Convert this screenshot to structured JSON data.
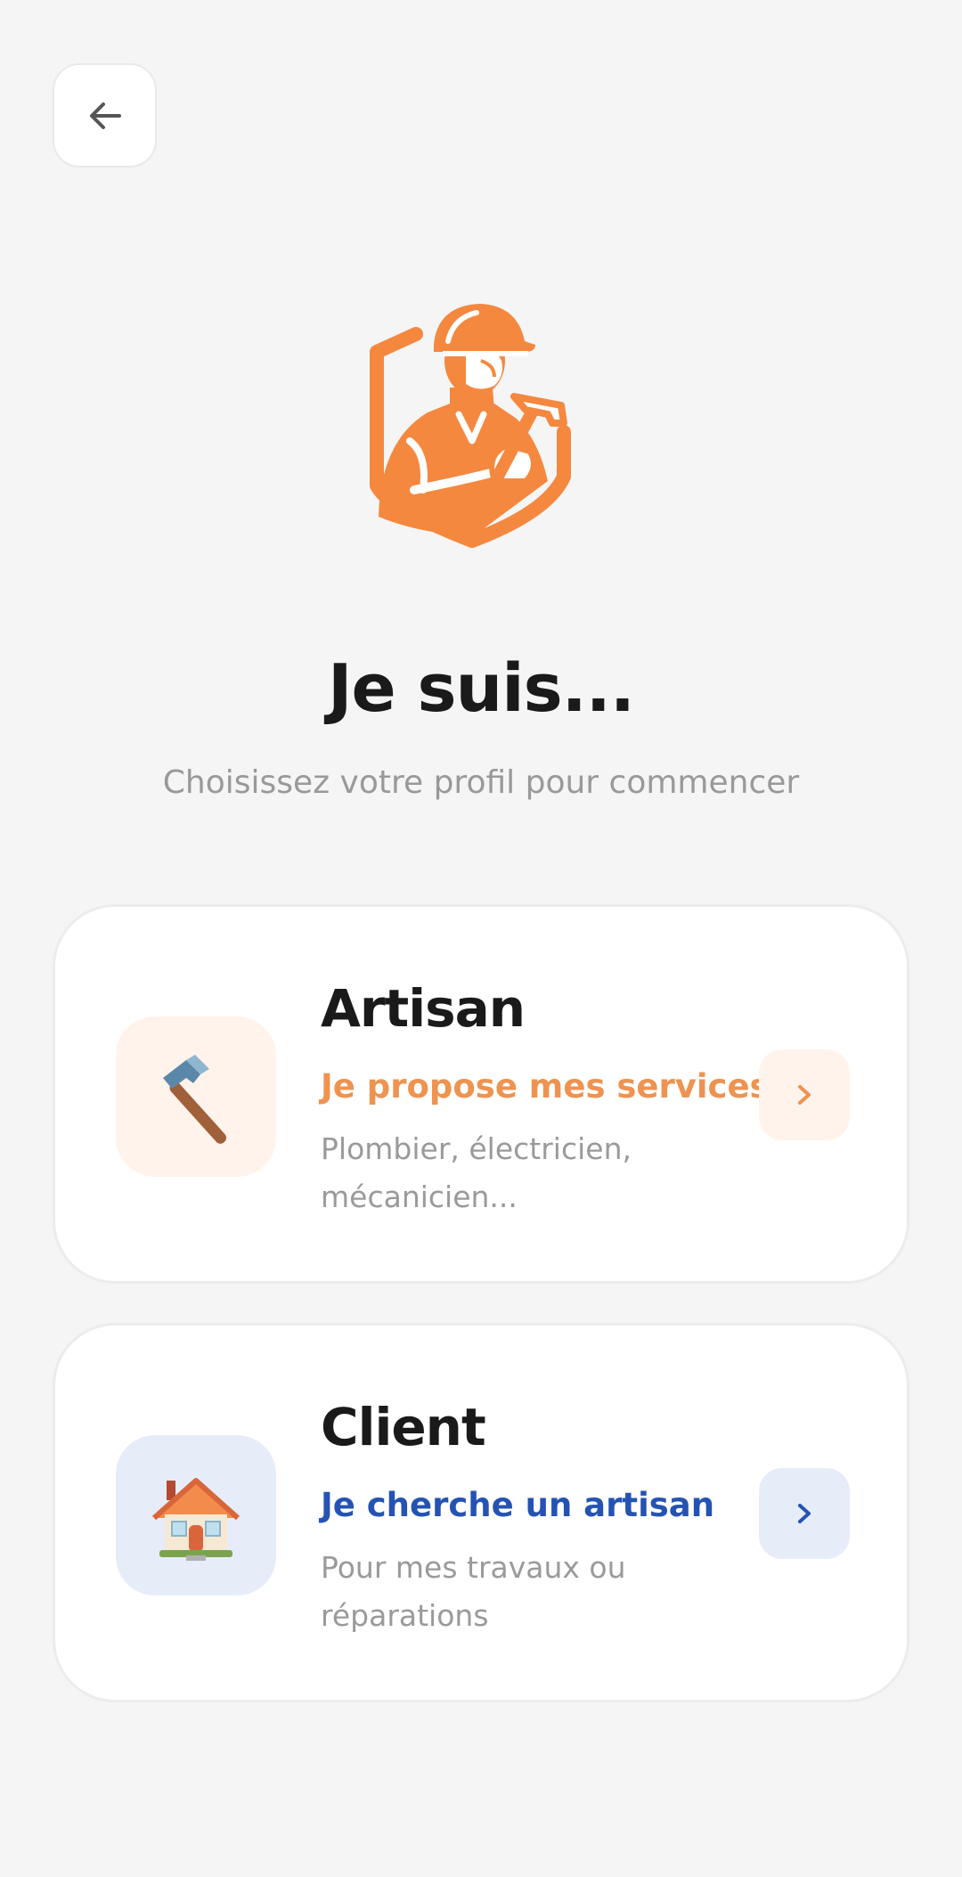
{
  "header": {
    "back_icon": "arrow-left-icon"
  },
  "logo": {
    "icon": "worker-with-hammer-logo",
    "color": "#f5883f"
  },
  "heading": {
    "title": "Je suis...",
    "subtitle": "Choisissez votre profil pour commencer"
  },
  "profiles": [
    {
      "title": "Artisan",
      "tagline": "Je propose mes services",
      "description": "Plombier, électricien, mécanicien...",
      "icon": "hammer-icon",
      "accent": "#ee9350",
      "tint": "#fff3ec"
    },
    {
      "title": "Client",
      "tagline": "Je cherche un artisan",
      "description": "Pour mes travaux ou réparations",
      "icon": "house-icon",
      "accent": "#2453b3",
      "tint": "#e7ecf9"
    }
  ]
}
